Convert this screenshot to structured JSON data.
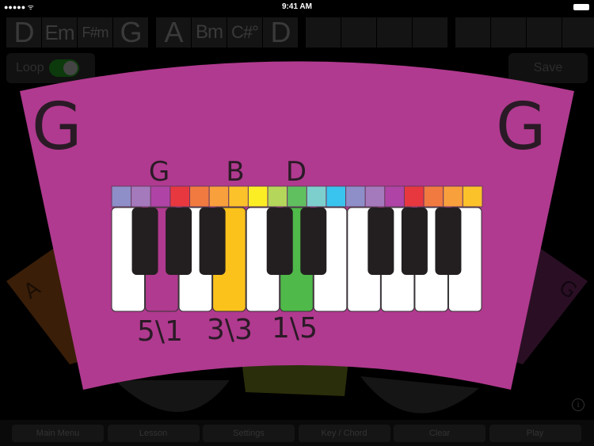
{
  "status_bar": {
    "time": "9:41 AM",
    "signal": "●●●●● ᯤ"
  },
  "chord_strip": [
    {
      "label": "D",
      "size": 36,
      "w": 44
    },
    {
      "label": "Em",
      "size": 26,
      "w": 44
    },
    {
      "label": "F#m",
      "size": 18,
      "w": 44
    },
    {
      "label": "G",
      "size": 36,
      "w": 44
    },
    {
      "label": "A",
      "size": 36,
      "w": 44
    },
    {
      "label": "Bm",
      "size": 24,
      "w": 44
    },
    {
      "label": "C#°",
      "size": 22,
      "w": 44
    },
    {
      "label": "D",
      "size": 36,
      "w": 44
    },
    {
      "label": "",
      "w": 44
    },
    {
      "label": "",
      "w": 44
    },
    {
      "label": "",
      "w": 44
    },
    {
      "label": "",
      "w": 44
    },
    {
      "label": "",
      "w": 44
    },
    {
      "label": "",
      "w": 44
    },
    {
      "label": "",
      "w": 44
    },
    {
      "label": "",
      "w": 44
    }
  ],
  "loop": {
    "label": "Loop",
    "on": true
  },
  "save_label": "Save",
  "card": {
    "chord_left": "G",
    "chord_right": "G",
    "color": "#b03a8f",
    "note_labels": [
      "G",
      "B",
      "D"
    ],
    "fingerings": [
      "5\\1",
      "3\\3",
      "1\\5"
    ],
    "color_strip": [
      "#8e8fc8",
      "#a47abc",
      "#b044a6",
      "#e8383f",
      "#f07a40",
      "#f8a03c",
      "#fcc22a",
      "#fcee24",
      "#b4d65a",
      "#60c060",
      "#7ccfcc",
      "#38c4ee",
      "#8e8fc8",
      "#a47abc",
      "#b044a6",
      "#e8383f",
      "#f07a40",
      "#f8a03c",
      "#fcc22a"
    ],
    "highlighted_white_keys": [
      {
        "index": 1,
        "color": "#b03a8f"
      },
      {
        "index": 3,
        "color": "#fcc21c"
      },
      {
        "index": 5,
        "color": "#4fb94a"
      }
    ]
  },
  "side_cards": {
    "left": "A",
    "right": "G"
  },
  "bottom_bar": [
    "Main Menu",
    "Lesson",
    "Settings",
    "Key / Chord",
    "Clear",
    "Play"
  ],
  "info_icon": "i"
}
